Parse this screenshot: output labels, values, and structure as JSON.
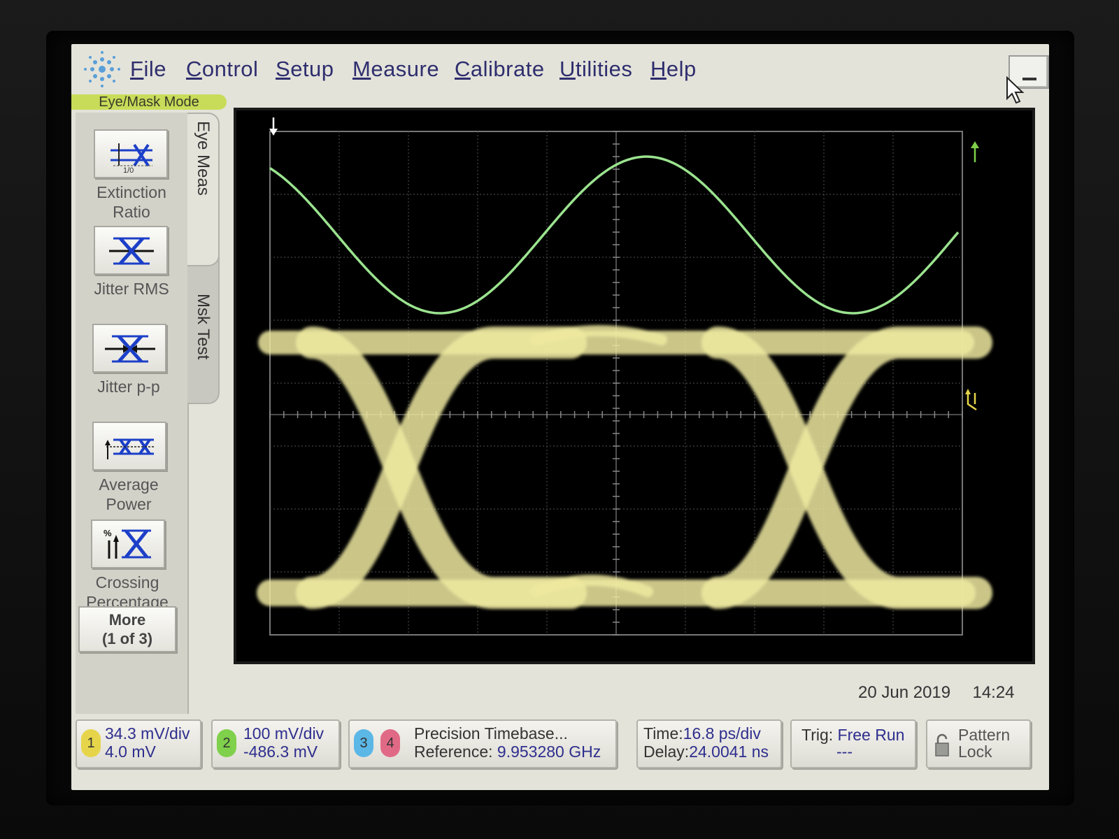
{
  "menu": {
    "items": [
      "File",
      "Control",
      "Setup",
      "Measure",
      "Calibrate",
      "Utilities",
      "Help"
    ]
  },
  "mode_label": "Eye/Mask Mode",
  "tabs": {
    "eye_meas": "Eye Meas",
    "msk_test": "Msk Test"
  },
  "measurements": [
    {
      "label_line1": "Extinction",
      "label_line2": "Ratio",
      "icon": "extinction-ratio-icon"
    },
    {
      "label_line1": "Jitter RMS",
      "label_line2": "",
      "icon": "jitter-rms-icon"
    },
    {
      "label_line1": "Jitter p-p",
      "label_line2": "",
      "icon": "jitter-pp-icon"
    },
    {
      "label_line1": "Average",
      "label_line2": "Power",
      "icon": "average-power-icon"
    },
    {
      "label_line1": "Crossing",
      "label_line2": "Percentage",
      "icon": "crossing-percentage-icon"
    }
  ],
  "more_button": {
    "line1": "More",
    "line2": "(1 of 3)"
  },
  "datetime": {
    "date": "20 Jun 2019",
    "time": "14:24"
  },
  "channels": {
    "ch1": {
      "number": "1",
      "scale": "34.3 mV/div",
      "offset": "4.0 mV",
      "color": "#e6d54a"
    },
    "ch2": {
      "number": "2",
      "scale": "100 mV/div",
      "offset": "-486.3 mV",
      "color": "#7fd04a"
    },
    "ch3": {
      "number": "3",
      "color": "#5bb7e6"
    },
    "ch4": {
      "number": "4",
      "color": "#e06a86"
    }
  },
  "timebase": {
    "title": "Precision Timebase...",
    "reference_label": "Reference:",
    "reference_value": "9.953280 GHz",
    "time_label": "Time:",
    "time_value": "16.8 ps/div",
    "delay_label": "Delay:",
    "delay_value": "24.0041 ns"
  },
  "trigger": {
    "label": "Trig:",
    "value": "Free Run",
    "sub": "---"
  },
  "pattern_lock": {
    "line1": "Pattern",
    "line2": "Lock"
  },
  "colors": {
    "eye_trace": "#efe9a0",
    "sine_trace": "#9be38f",
    "menu_text": "#2e2e6e"
  }
}
